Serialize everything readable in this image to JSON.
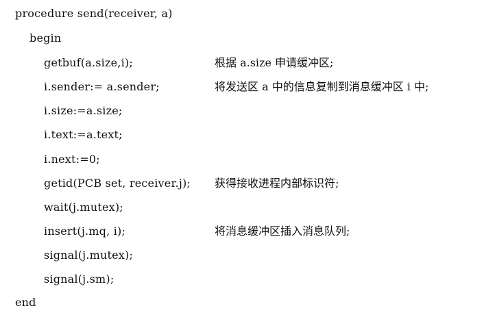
{
  "procedure": {
    "header": "procedure send(receiver, a)",
    "begin": "begin",
    "end": "end",
    "statements": [
      {
        "code": "getbuf(a.size,i);",
        "comment": "根据 a.size 申请缓冲区;"
      },
      {
        "code": "i.sender:= a.sender;",
        "comment": "将发送区 a 中的信息复制到消息缓冲区 i 中;"
      },
      {
        "code": "i.size:=a.size;",
        "comment": ""
      },
      {
        "code": "i.text:=a.text;",
        "comment": ""
      },
      {
        "code": "i.next:=0;",
        "comment": ""
      },
      {
        "code": "getid(PCB set, receiver.j);",
        "comment": "获得接收进程内部标识符;"
      },
      {
        "code": "wait(j.mutex);",
        "comment": ""
      },
      {
        "code": "insert(j.mq, i);",
        "comment": "将消息缓冲区插入消息队列;"
      },
      {
        "code": "signal(j.mutex);",
        "comment": ""
      },
      {
        "code": "signal(j.sm);",
        "comment": ""
      }
    ]
  }
}
